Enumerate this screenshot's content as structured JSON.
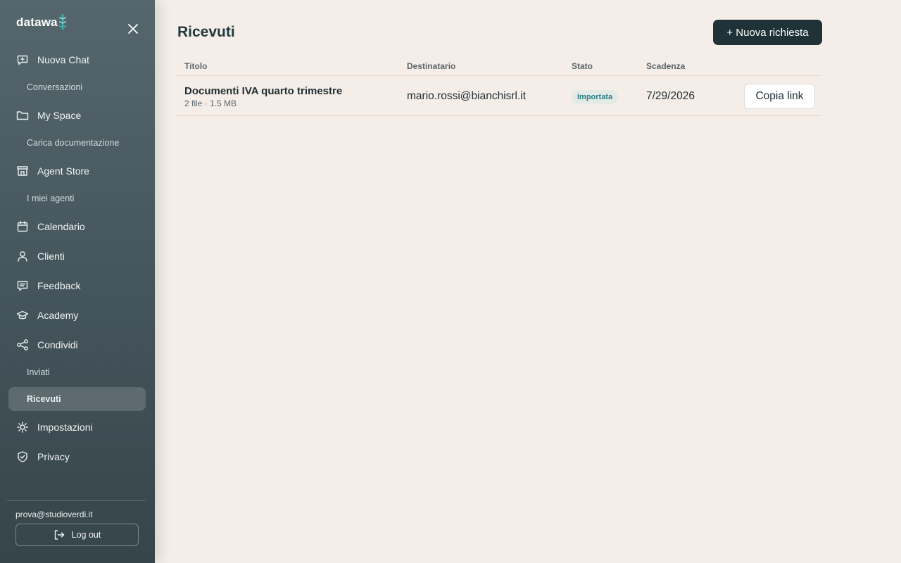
{
  "brand": {
    "name": "datawa",
    "accent": "#3fb3ad"
  },
  "sidebar": {
    "items": [
      {
        "label": "Nuova Chat",
        "icon": "chat-plus-icon"
      },
      {
        "label": "Conversazioni"
      },
      {
        "label": "My Space",
        "icon": "folder-icon"
      },
      {
        "label": "Carica documentazione"
      },
      {
        "label": "Agent Store",
        "icon": "store-icon"
      },
      {
        "label": "I miei agenti"
      },
      {
        "label": "Calendario",
        "icon": "calendar-icon"
      },
      {
        "label": "Clienti",
        "icon": "user-icon"
      },
      {
        "label": "Feedback",
        "icon": "feedback-icon"
      },
      {
        "label": "Academy",
        "icon": "graduation-cap-icon"
      },
      {
        "label": "Condividi",
        "icon": "share-icon"
      },
      {
        "label": "Inviati"
      },
      {
        "label": "Ricevuti",
        "active": true
      },
      {
        "label": "Impostazioni",
        "icon": "gear-icon"
      },
      {
        "label": "Privacy",
        "icon": "shield-check-icon"
      }
    ],
    "user_email": "prova@studioverdi.it",
    "logout_label": "Log out"
  },
  "main": {
    "title": "Ricevuti",
    "new_button_label": "+ Nuova richiesta",
    "table": {
      "columns": [
        "Titolo",
        "Destinatario",
        "Stato",
        "Scadenza"
      ],
      "rows": [
        {
          "title": "Documenti IVA quarto trimestre",
          "meta": "2 file · 1.5 MB",
          "recipient": "mario.rossi@bianchisrl.it",
          "status": "Importata",
          "due": "7/29/2026",
          "action_label": "Copia link"
        }
      ]
    }
  },
  "colors": {
    "sidebar_bg": "#4a5b61",
    "page_bg": "#f5ede7",
    "primary_button": "#1e3237",
    "status_badge_text": "#2d7f86"
  }
}
